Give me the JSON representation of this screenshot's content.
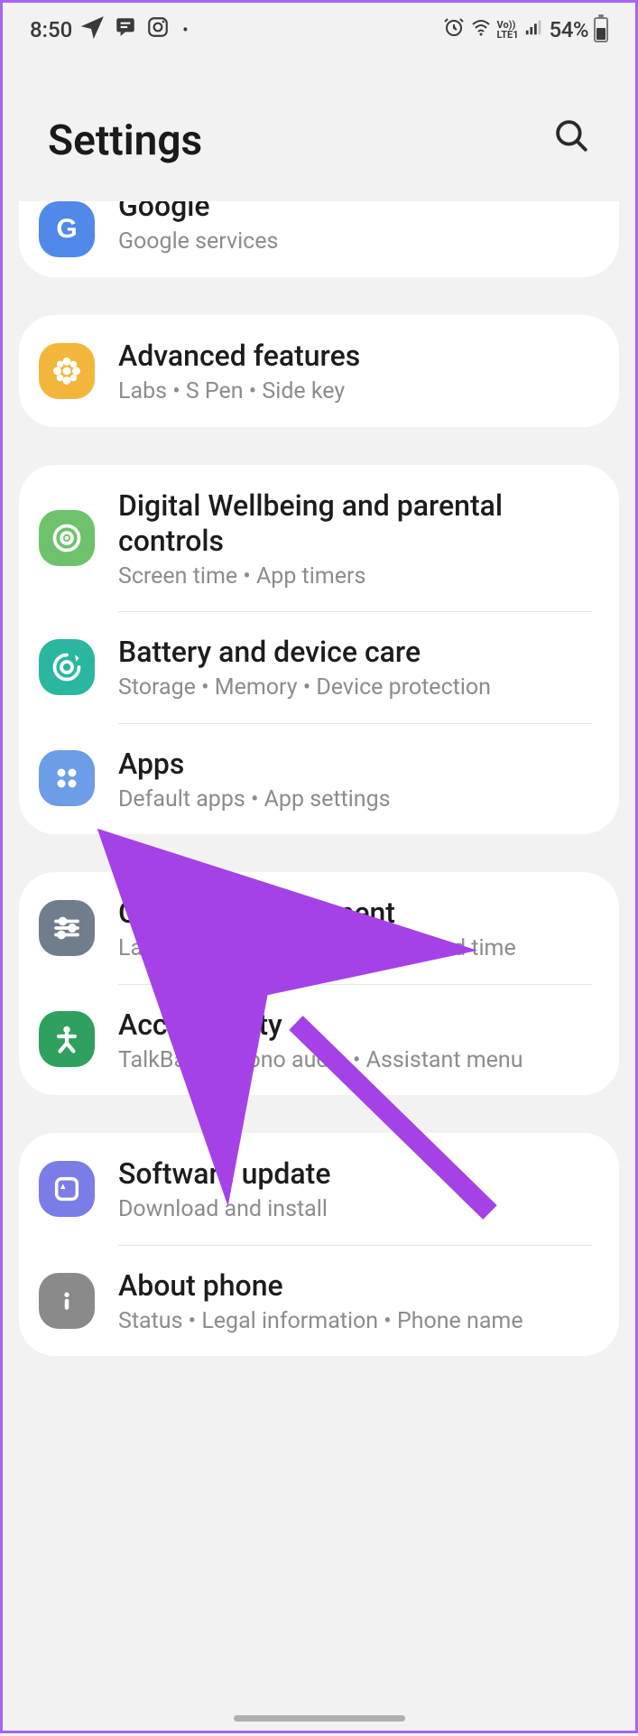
{
  "status_bar": {
    "time": "8:50",
    "battery_pct": "54%"
  },
  "header": {
    "title": "Settings"
  },
  "groups": [
    {
      "top_cut": true,
      "items": [
        {
          "id": "google",
          "title": "Google",
          "subtitle": "Google services",
          "icon_bg": "#5089e9",
          "icon_name": "google-icon",
          "icon_svg": "G"
        }
      ]
    },
    {
      "items": [
        {
          "id": "advanced-features",
          "title": "Advanced features",
          "subtitle": "Labs  •  S Pen  •  Side key",
          "icon_bg": "#f2b63a",
          "icon_name": "gear-flower-icon",
          "icon_svg": "flower"
        }
      ]
    },
    {
      "items": [
        {
          "id": "digital-wellbeing",
          "title": "Digital Wellbeing and parental controls",
          "subtitle": "Screen time  •  App timers",
          "icon_bg": "#6dc26b",
          "icon_name": "wellbeing-icon",
          "icon_svg": "circle-ring"
        },
        {
          "id": "device-care",
          "title": "Battery and device care",
          "subtitle": "Storage  •  Memory  •  Device protection",
          "icon_bg": "#2bb6a0",
          "icon_name": "device-care-icon",
          "icon_svg": "swirl"
        },
        {
          "id": "apps",
          "title": "Apps",
          "subtitle": "Default apps  •  App settings",
          "icon_bg": "#6d9ce8",
          "icon_name": "apps-icon",
          "icon_svg": "dots4"
        }
      ]
    },
    {
      "items": [
        {
          "id": "general-management",
          "title": "General management",
          "subtitle": "Language and keyboard  •  Date and time",
          "icon_bg": "#6f7d8c",
          "icon_name": "sliders-icon",
          "icon_svg": "sliders"
        },
        {
          "id": "accessibility",
          "title": "Accessibility",
          "subtitle": "TalkBack  •  Mono audio  •  Assistant menu",
          "icon_bg": "#2fa05d",
          "icon_name": "accessibility-icon",
          "icon_svg": "person"
        }
      ]
    },
    {
      "items": [
        {
          "id": "software-update",
          "title": "Software update",
          "subtitle": "Download and install",
          "icon_bg": "#7a7ce8",
          "icon_name": "update-icon",
          "icon_svg": "cycle"
        },
        {
          "id": "about-phone",
          "title": "About phone",
          "subtitle": "Status  •  Legal information  •  Phone name",
          "icon_bg": "#8a8a8a",
          "icon_name": "info-icon",
          "icon_svg": "info"
        }
      ]
    }
  ],
  "annotation_arrow": {
    "color": "#a442e8",
    "target": "apps"
  }
}
